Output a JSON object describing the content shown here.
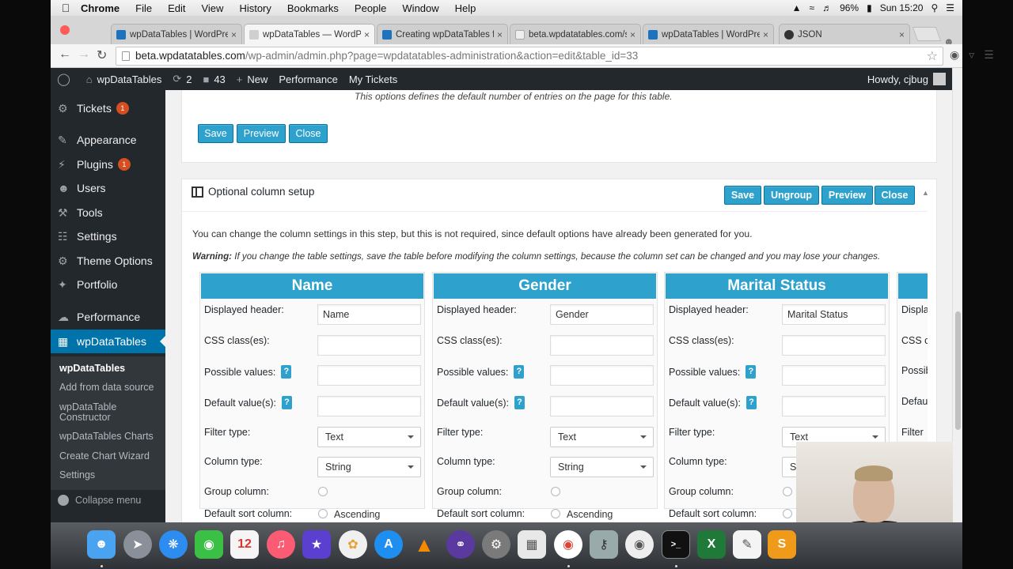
{
  "menubar": {
    "app": "Chrome",
    "items": [
      "File",
      "Edit",
      "View",
      "History",
      "Bookmarks",
      "People",
      "Window",
      "Help"
    ],
    "battery": "96%",
    "clock": "Sun 15:20"
  },
  "tabs": [
    {
      "label": "wpDataTables | WordPre",
      "color": "#1e73be"
    },
    {
      "label": "wpDataTables — WordPre",
      "color": "#cccccc"
    },
    {
      "label": "Creating wpDataTables fr",
      "color": "#1e73be"
    },
    {
      "label": "beta.wpdatatables.com/s",
      "color": "#eeeeee"
    },
    {
      "label": "wpDataTables | WordPre",
      "color": "#1e73be"
    },
    {
      "label": "JSON",
      "color": "#333333"
    }
  ],
  "address": {
    "host": "beta.wpdatatables.com",
    "path": "/wp-admin/admin.php?page=wpdatatables-administration&action=edit&table_id=33"
  },
  "wpbar": {
    "site": "wpDataTables",
    "updates": "2",
    "comments": "43",
    "new": "New",
    "performance": "Performance",
    "tickets": "My Tickets",
    "howdy": "Howdy, cjbug"
  },
  "sidebar": {
    "items": [
      {
        "label": "Tickets",
        "icon": "gear-icon",
        "badge": "1"
      },
      {
        "label": "Appearance",
        "icon": "brush-icon"
      },
      {
        "label": "Plugins",
        "icon": "plug-icon",
        "badge": "1"
      },
      {
        "label": "Users",
        "icon": "user-icon"
      },
      {
        "label": "Tools",
        "icon": "wrench-icon"
      },
      {
        "label": "Settings",
        "icon": "sliders-icon"
      },
      {
        "label": "Theme Options",
        "icon": "gear-icon"
      },
      {
        "label": "Portfolio",
        "icon": "pin-icon"
      },
      {
        "label": "Performance",
        "icon": "cloud-icon"
      },
      {
        "label": "wpDataTables",
        "icon": "table-icon"
      }
    ],
    "sub": [
      "wpDataTables",
      "Add from data source",
      "wpDataTable",
      "Constructor",
      "wpDataTables Charts",
      "Create Chart Wizard",
      "Settings"
    ],
    "collapse": "Collapse menu"
  },
  "top_card": {
    "hint": "This options defines the default number of entries on the page for this table.",
    "buttons": [
      "Save",
      "Preview",
      "Close"
    ]
  },
  "column_setup": {
    "title": "Optional column setup",
    "buttons": [
      "Save",
      "Ungroup",
      "Preview",
      "Close"
    ],
    "description": "You can change the column settings in this step, but this is not required, since default options have already been generated for you.",
    "warning_label": "Warning:",
    "warning": "If you change the table settings, save the table before modifying the column settings, because the column set can be changed and you may lose your changes.",
    "labels": {
      "header": "Displayed header:",
      "css": "CSS class(es):",
      "possible": "Possible values:",
      "default": "Default value(s):",
      "filter": "Filter type:",
      "coltype": "Column type:",
      "group": "Group column:",
      "sort": "Default sort column:",
      "ascending": "Ascending",
      "help": "?"
    },
    "columns": [
      {
        "name": "Name",
        "header": "Name",
        "filter": "Text",
        "type": "String"
      },
      {
        "name": "Gender",
        "header": "Gender",
        "filter": "Text",
        "type": "String"
      },
      {
        "name": "Marital Status",
        "header": "Marital Status",
        "filter": "Text",
        "type": "St"
      }
    ],
    "partial": {
      "label1": "Displa",
      "label2": "CSS cl",
      "label3": "Possib",
      "label4": "Defau",
      "label5": "Filter"
    }
  },
  "colors": {
    "accent": "#2ea2cc",
    "wp_dark": "#23282d",
    "wp_blue": "#0073aa",
    "badge": "#d54e21"
  }
}
